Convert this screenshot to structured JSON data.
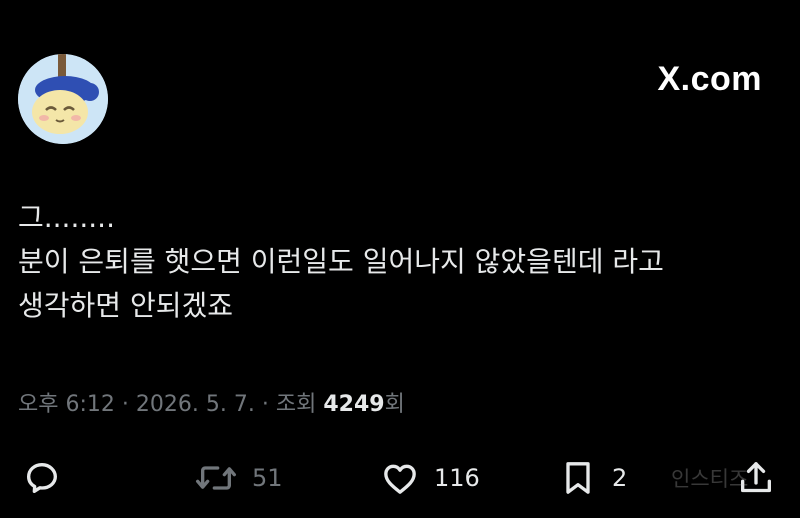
{
  "header": {
    "brand": "X.com"
  },
  "tweet": {
    "lines": [
      "그........",
      "분이 은퇴를 햇으면 이런일도 일어나지 않았을텐데 라고",
      "생각하면 안되겠죠"
    ],
    "time": "오후 6:12",
    "date": "2026. 5. 7.",
    "views_label": "조회",
    "views": "4249",
    "views_suffix": "회"
  },
  "actions": {
    "reply_icon": "reply-icon",
    "retweet_icon": "retweet-icon",
    "retweet_count": "51",
    "like_icon": "heart-icon",
    "like_count": "116",
    "bookmark_icon": "bookmark-icon",
    "bookmark_count": "2",
    "share_icon": "share-icon"
  },
  "watermark": "인스티즈",
  "colors": {
    "background": "#000000",
    "text": "#e7e9ea",
    "secondary": "#71767b",
    "icon_active": "#e7e9ea"
  }
}
